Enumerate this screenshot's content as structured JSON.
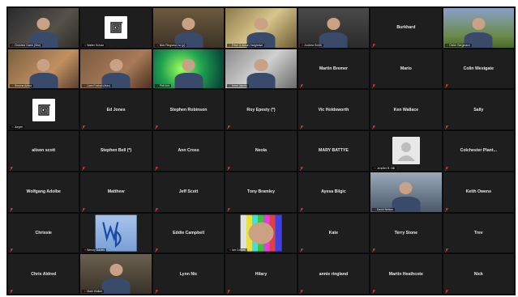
{
  "participants": [
    {
      "kind": "video",
      "style": "v1",
      "label": "Christine Gwen (She)"
    },
    {
      "kind": "logo",
      "label": "Walter Schulz"
    },
    {
      "kind": "video",
      "style": "v2",
      "label": "Nick Ringland, ho (p)"
    },
    {
      "kind": "video",
      "style": "v3",
      "label": "Peter & Alison Hargreave"
    },
    {
      "kind": "video",
      "style": "v4",
      "label": "Andrew Smith"
    },
    {
      "kind": "name",
      "name": "Burkhard"
    },
    {
      "kind": "video",
      "style": "v5",
      "label": "Dieter Bergmann"
    },
    {
      "kind": "video",
      "style": "v6",
      "label": "Simone Arthur"
    },
    {
      "kind": "video",
      "style": "v7",
      "label": "Liam Foxhall (Max)"
    },
    {
      "kind": "video",
      "style": "v8",
      "label": "Phil Kirk"
    },
    {
      "kind": "video",
      "style": "v9",
      "label": "Irene James"
    },
    {
      "kind": "name",
      "name": "Martin Bremer"
    },
    {
      "kind": "name",
      "name": "Mario"
    },
    {
      "kind": "name",
      "name": "Colin Westgate"
    },
    {
      "kind": "logo",
      "label": "Jurgen"
    },
    {
      "kind": "name",
      "name": "Ed Jones"
    },
    {
      "kind": "name",
      "name": "Stephen Robinson"
    },
    {
      "kind": "name",
      "name": "Roy Epesty (*)"
    },
    {
      "kind": "name",
      "name": "Vic Holdsworth"
    },
    {
      "kind": "name",
      "name": "Ken Wallace"
    },
    {
      "kind": "name",
      "name": "Sally"
    },
    {
      "kind": "name",
      "name": "alison scott"
    },
    {
      "kind": "name",
      "name": "Stephen Bell (*)"
    },
    {
      "kind": "name",
      "name": "Ann Cross"
    },
    {
      "kind": "name",
      "name": "Neola"
    },
    {
      "kind": "name",
      "name": "MARY BATTYE"
    },
    {
      "kind": "placeholder",
      "label": "Jennifer B. Hill"
    },
    {
      "kind": "name",
      "name": "Colchester Plant..."
    },
    {
      "kind": "name",
      "name": "Wolfgang Adolbe"
    },
    {
      "kind": "name",
      "name": "Matthew"
    },
    {
      "kind": "name",
      "name": "Jeff Scott"
    },
    {
      "kind": "name",
      "name": "Tony Bramley"
    },
    {
      "kind": "name",
      "name": "Ayesa Bilgic"
    },
    {
      "kind": "photo",
      "style": "v10",
      "label": "David Nelson"
    },
    {
      "kind": "name",
      "name": "Keith Owens"
    },
    {
      "kind": "name",
      "name": "Chrissie"
    },
    {
      "kind": "wd",
      "label": "Wendy Davies"
    },
    {
      "kind": "name",
      "name": "Eddie Campbell"
    },
    {
      "kind": "testcard",
      "label": "Ian Cottam"
    },
    {
      "kind": "name",
      "name": "Kate"
    },
    {
      "kind": "name",
      "name": "Terry Stone"
    },
    {
      "kind": "name",
      "name": "Trev"
    },
    {
      "kind": "name",
      "name": "Chris Aldred"
    },
    {
      "kind": "photo",
      "style": "v11",
      "label": "Mark Walker"
    },
    {
      "kind": "name",
      "name": "Lynn Nic",
      "dot": true
    },
    {
      "kind": "name",
      "name": "Hilary"
    },
    {
      "kind": "name",
      "name": "annie ringland"
    },
    {
      "kind": "name",
      "name": "Martin Heathcote"
    },
    {
      "kind": "name",
      "name": "Nick"
    }
  ],
  "colors": {
    "accent": "#2d8cff",
    "muted": "#e03a2f",
    "tile": "#1e1e1e"
  }
}
